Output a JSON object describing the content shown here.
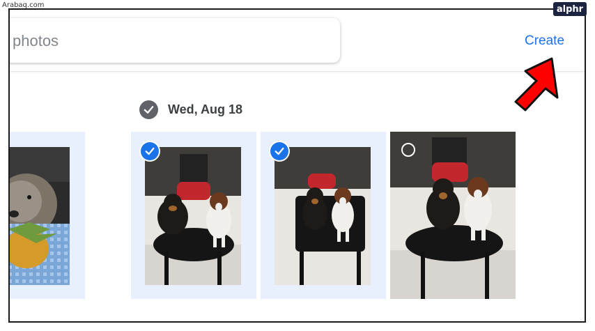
{
  "watermark": "Arabaq.com",
  "brand": {
    "logo_text": "alphr"
  },
  "search": {
    "visible_text": "photos"
  },
  "header": {
    "create_label": "Create"
  },
  "date_group": {
    "label": "Wed, Aug 18"
  },
  "photos": [
    {
      "description": "dog with pineapple",
      "selected": false
    },
    {
      "description": "two puppies on chair",
      "selected": true
    },
    {
      "description": "two puppies on chair",
      "selected": true
    },
    {
      "description": "two puppies on chair",
      "selected": false
    }
  ],
  "colors": {
    "accent": "#1a73e8",
    "selected_bg": "#e8f0fe",
    "arrow": "#ff0000",
    "check_gray": "#5f6368"
  },
  "icons": [
    "check-icon",
    "selection-circle-icon",
    "pointer-arrow-icon"
  ]
}
